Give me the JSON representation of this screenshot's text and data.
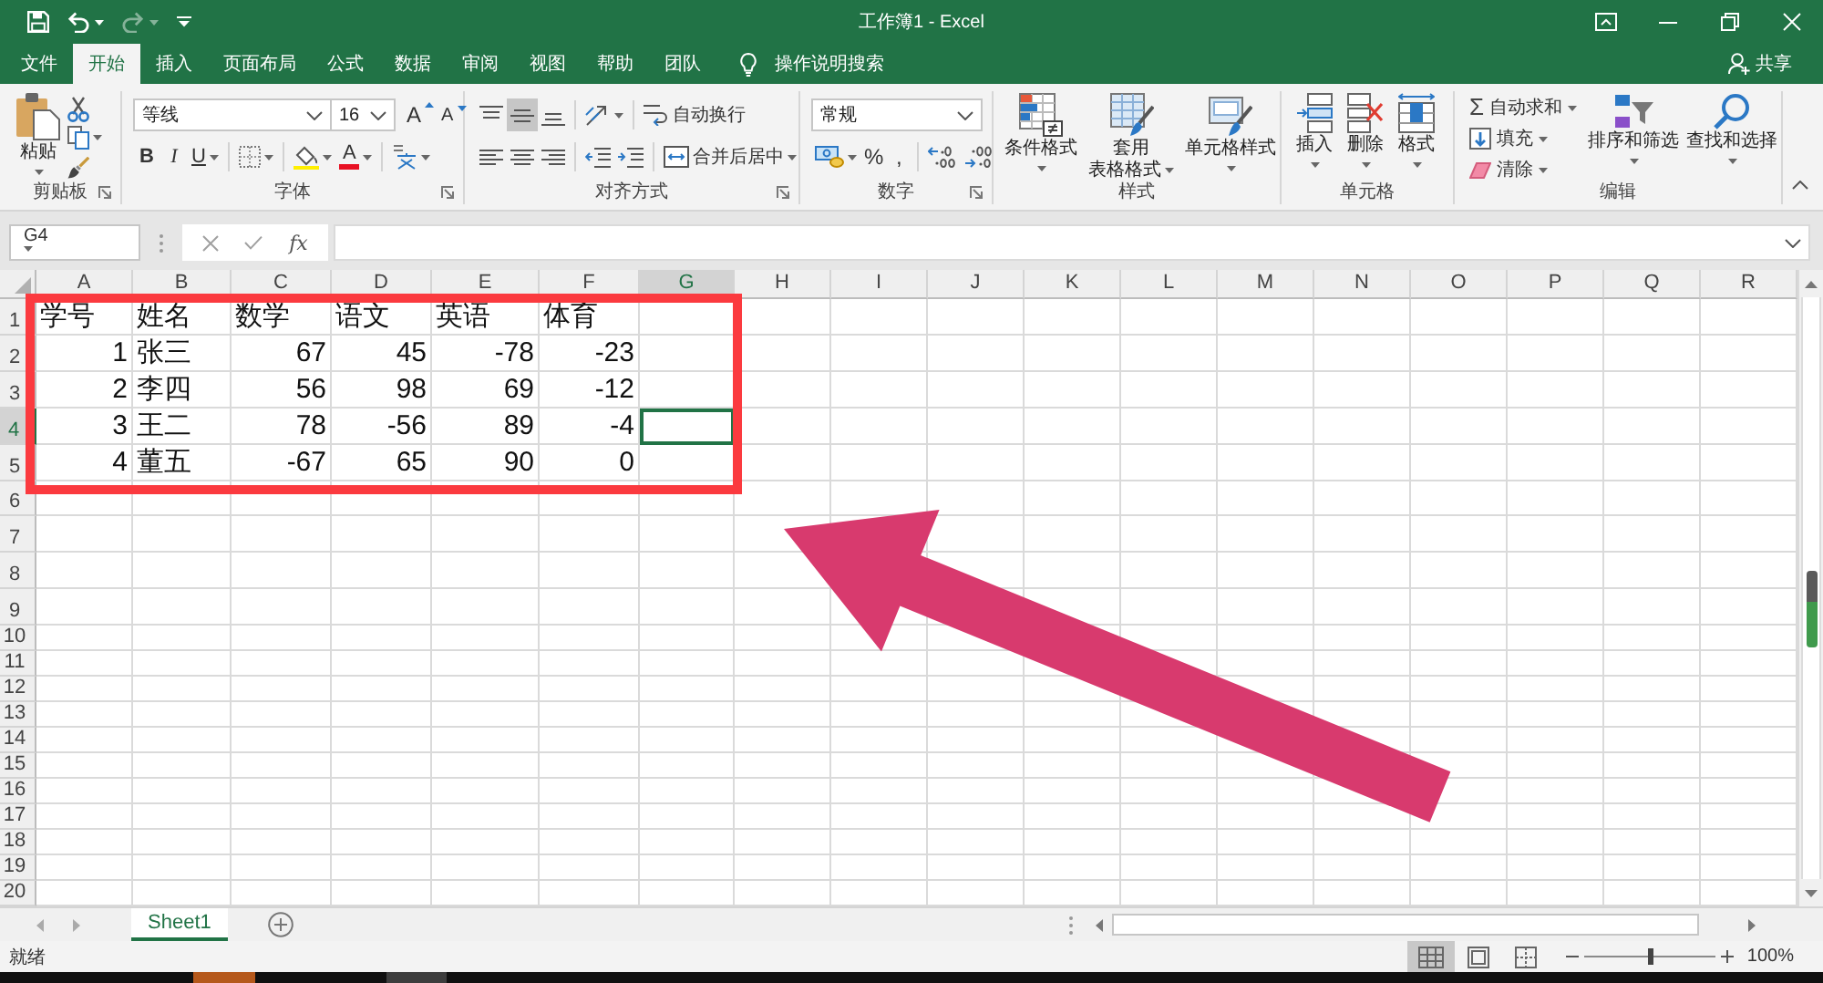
{
  "quick_access": [
    {
      "kind": "save",
      "disabled": false
    },
    {
      "kind": "undo",
      "disabled": false
    },
    {
      "kind": "redo",
      "disabled": true
    },
    {
      "kind": "customize",
      "disabled": false
    }
  ],
  "title_bar": {
    "title": "工作簿1 - Excel"
  },
  "tabs": [
    {
      "label": "文件",
      "selected": false
    },
    {
      "label": "开始",
      "selected": true
    },
    {
      "label": "插入",
      "selected": false
    },
    {
      "label": "页面布局",
      "selected": false
    },
    {
      "label": "公式",
      "selected": false
    },
    {
      "label": "数据",
      "selected": false
    },
    {
      "label": "审阅",
      "selected": false
    },
    {
      "label": "视图",
      "selected": false
    },
    {
      "label": "帮助",
      "selected": false
    },
    {
      "label": "团队",
      "selected": false
    }
  ],
  "tell_me": {
    "label": "操作说明搜索"
  },
  "share": {
    "label": "共享"
  },
  "ribbon": [
    {
      "kind": "clipboard",
      "label": "剪贴板",
      "paste": "粘贴"
    },
    {
      "kind": "font",
      "label": "字体",
      "font_name": "等线",
      "font_size": "16",
      "grow": "A",
      "shrink": "A",
      "bold": "B",
      "italic": "I",
      "underline": "U",
      "font_color": "A"
    },
    {
      "kind": "alignment",
      "label": "对齐方式",
      "vertical_align": [
        {
          "kind": "top",
          "selected": false
        },
        {
          "kind": "middle",
          "selected": true
        },
        {
          "kind": "bottom",
          "selected": false
        }
      ],
      "horizontal_align": [
        {
          "kind": "left",
          "selected": false
        },
        {
          "kind": "center",
          "selected": false
        },
        {
          "kind": "right",
          "selected": false
        }
      ],
      "wrap_text": "自动换行",
      "merge_center": "合并后居中"
    },
    {
      "kind": "number",
      "label": "数字",
      "format": "常规",
      "percent": "%",
      "comma": ","
    },
    {
      "kind": "styles",
      "label": "样式",
      "conditional_formatting": "条件格式",
      "format_as_table": [
        "套用",
        "表格格式"
      ],
      "cell_styles": "单元格样式"
    },
    {
      "kind": "cells",
      "label": "单元格",
      "insert": "插入",
      "delete": "删除",
      "format": "格式"
    },
    {
      "kind": "editing",
      "label": "编辑",
      "autosum_symbol": "Σ",
      "autosum": "自动求和",
      "fill": "填充",
      "clear": "清除",
      "sort_filter": "排序和筛选",
      "find_select": "查找和选择"
    }
  ],
  "formula_bar": {
    "name_box": "G4",
    "function_label": "fx"
  },
  "sheet": {
    "columns": [
      {
        "label": "A",
        "selected": false
      },
      {
        "label": "B",
        "selected": false
      },
      {
        "label": "C",
        "selected": false
      },
      {
        "label": "D",
        "selected": false
      },
      {
        "label": "E",
        "selected": false
      },
      {
        "label": "F",
        "selected": false
      },
      {
        "label": "G",
        "selected": true
      },
      {
        "label": "H",
        "selected": false
      },
      {
        "label": "I",
        "selected": false
      },
      {
        "label": "J",
        "selected": false
      },
      {
        "label": "K",
        "selected": false
      },
      {
        "label": "L",
        "selected": false
      },
      {
        "label": "M",
        "selected": false
      },
      {
        "label": "N",
        "selected": false
      },
      {
        "label": "O",
        "selected": false
      },
      {
        "label": "P",
        "selected": false
      },
      {
        "label": "Q",
        "selected": false
      },
      {
        "label": "R",
        "selected": false
      }
    ],
    "rows": [
      {
        "label": "1",
        "selected": false,
        "cells": [
          {
            "value": "学号",
            "kind": "text"
          },
          {
            "value": "姓名",
            "kind": "text"
          },
          {
            "value": "数学",
            "kind": "text"
          },
          {
            "value": "语文",
            "kind": "text"
          },
          {
            "value": "英语",
            "kind": "text"
          },
          {
            "value": "体育",
            "kind": "text"
          }
        ]
      },
      {
        "label": "2",
        "selected": false,
        "cells": [
          {
            "value": "1",
            "kind": "number"
          },
          {
            "value": "张三",
            "kind": "text"
          },
          {
            "value": "67",
            "kind": "number"
          },
          {
            "value": "45",
            "kind": "number"
          },
          {
            "value": "-78",
            "kind": "number"
          },
          {
            "value": "-23",
            "kind": "number"
          }
        ]
      },
      {
        "label": "3",
        "selected": false,
        "cells": [
          {
            "value": "2",
            "kind": "number"
          },
          {
            "value": "李四",
            "kind": "text"
          },
          {
            "value": "56",
            "kind": "number"
          },
          {
            "value": "98",
            "kind": "number"
          },
          {
            "value": "69",
            "kind": "number"
          },
          {
            "value": "-12",
            "kind": "number"
          }
        ]
      },
      {
        "label": "4",
        "selected": true,
        "cells": [
          {
            "value": "3",
            "kind": "number"
          },
          {
            "value": "王二",
            "kind": "text"
          },
          {
            "value": "78",
            "kind": "number"
          },
          {
            "value": "-56",
            "kind": "number"
          },
          {
            "value": "89",
            "kind": "number"
          },
          {
            "value": "-4",
            "kind": "number"
          }
        ]
      },
      {
        "label": "5",
        "selected": false,
        "cells": [
          {
            "value": "4",
            "kind": "number"
          },
          {
            "value": "董五",
            "kind": "text"
          },
          {
            "value": "-67",
            "kind": "number"
          },
          {
            "value": "65",
            "kind": "number"
          },
          {
            "value": "90",
            "kind": "number"
          },
          {
            "value": "0",
            "kind": "number"
          }
        ]
      },
      {
        "label": "6",
        "selected": false
      },
      {
        "label": "7",
        "selected": false
      },
      {
        "label": "8",
        "selected": false
      },
      {
        "label": "9",
        "selected": false
      },
      {
        "label": "10",
        "selected": false
      },
      {
        "label": "11",
        "selected": false
      },
      {
        "label": "12",
        "selected": false
      },
      {
        "label": "13",
        "selected": false
      },
      {
        "label": "14",
        "selected": false
      },
      {
        "label": "15",
        "selected": false
      },
      {
        "label": "16",
        "selected": false
      },
      {
        "label": "17",
        "selected": false
      },
      {
        "label": "18",
        "selected": false
      },
      {
        "label": "19",
        "selected": false
      },
      {
        "label": "20",
        "selected": false
      }
    ]
  },
  "sheet_tabs": [
    {
      "label": "Sheet1",
      "selected": true
    }
  ],
  "status_bar": {
    "status": "就绪",
    "view_buttons": [
      {
        "kind": "normal",
        "selected": true
      },
      {
        "kind": "page_layout",
        "selected": false
      },
      {
        "kind": "page_break_preview",
        "selected": false
      }
    ],
    "zoom": {
      "level": 0.5,
      "reading": "100%"
    }
  }
}
